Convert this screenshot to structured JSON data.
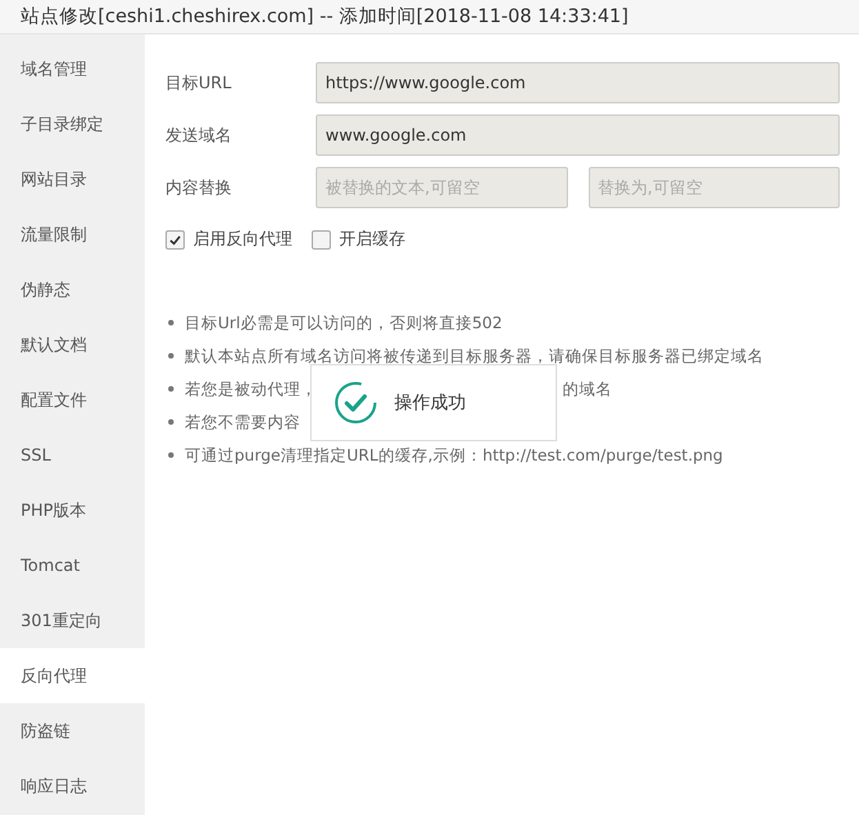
{
  "window": {
    "title": "站点修改[ceshi1.cheshirex.com] -- 添加时间[2018-11-08 14:33:41]"
  },
  "sidebar": {
    "items": [
      {
        "label": "域名管理",
        "selected": false
      },
      {
        "label": "子目录绑定",
        "selected": false
      },
      {
        "label": "网站目录",
        "selected": false
      },
      {
        "label": "流量限制",
        "selected": false
      },
      {
        "label": "伪静态",
        "selected": false
      },
      {
        "label": "默认文档",
        "selected": false
      },
      {
        "label": "配置文件",
        "selected": false
      },
      {
        "label": "SSL",
        "selected": false
      },
      {
        "label": "PHP版本",
        "selected": false
      },
      {
        "label": "Tomcat",
        "selected": false
      },
      {
        "label": "301重定向",
        "selected": false
      },
      {
        "label": "反向代理",
        "selected": true
      },
      {
        "label": "防盗链",
        "selected": false
      },
      {
        "label": "响应日志",
        "selected": false
      }
    ]
  },
  "form": {
    "fields": [
      {
        "label": "目标URL",
        "inputs": [
          {
            "value": "https://www.google.com"
          }
        ]
      },
      {
        "label": "发送域名",
        "inputs": [
          {
            "value": "www.google.com"
          }
        ]
      },
      {
        "label": "内容替换",
        "inputs": [
          {
            "placeholder": "被替换的文本,可留空"
          },
          {
            "placeholder": "替换为,可留空"
          }
        ]
      }
    ],
    "checkboxes": [
      {
        "label": "启用反向代理",
        "checked": true
      },
      {
        "label": "开启缓存",
        "checked": false
      }
    ]
  },
  "notes": [
    {
      "parts": [
        "目标Url必需是可以访问的，否则将直接502"
      ]
    },
    {
      "parts": [
        "默认本站点所有域名访问将被传递到目标服务器，请确保目标服务器已绑定域名"
      ]
    },
    {
      "parts": [
        "若您是被动代理，",
        "的域名"
      ]
    },
    {
      "parts": [
        "若您不需要内容"
      ]
    },
    {
      "parts": [
        "可通过purge清理指定URL的缓存,示例：http://test.com/purge/test.png"
      ]
    }
  ],
  "toast": {
    "message": "操作成功"
  }
}
